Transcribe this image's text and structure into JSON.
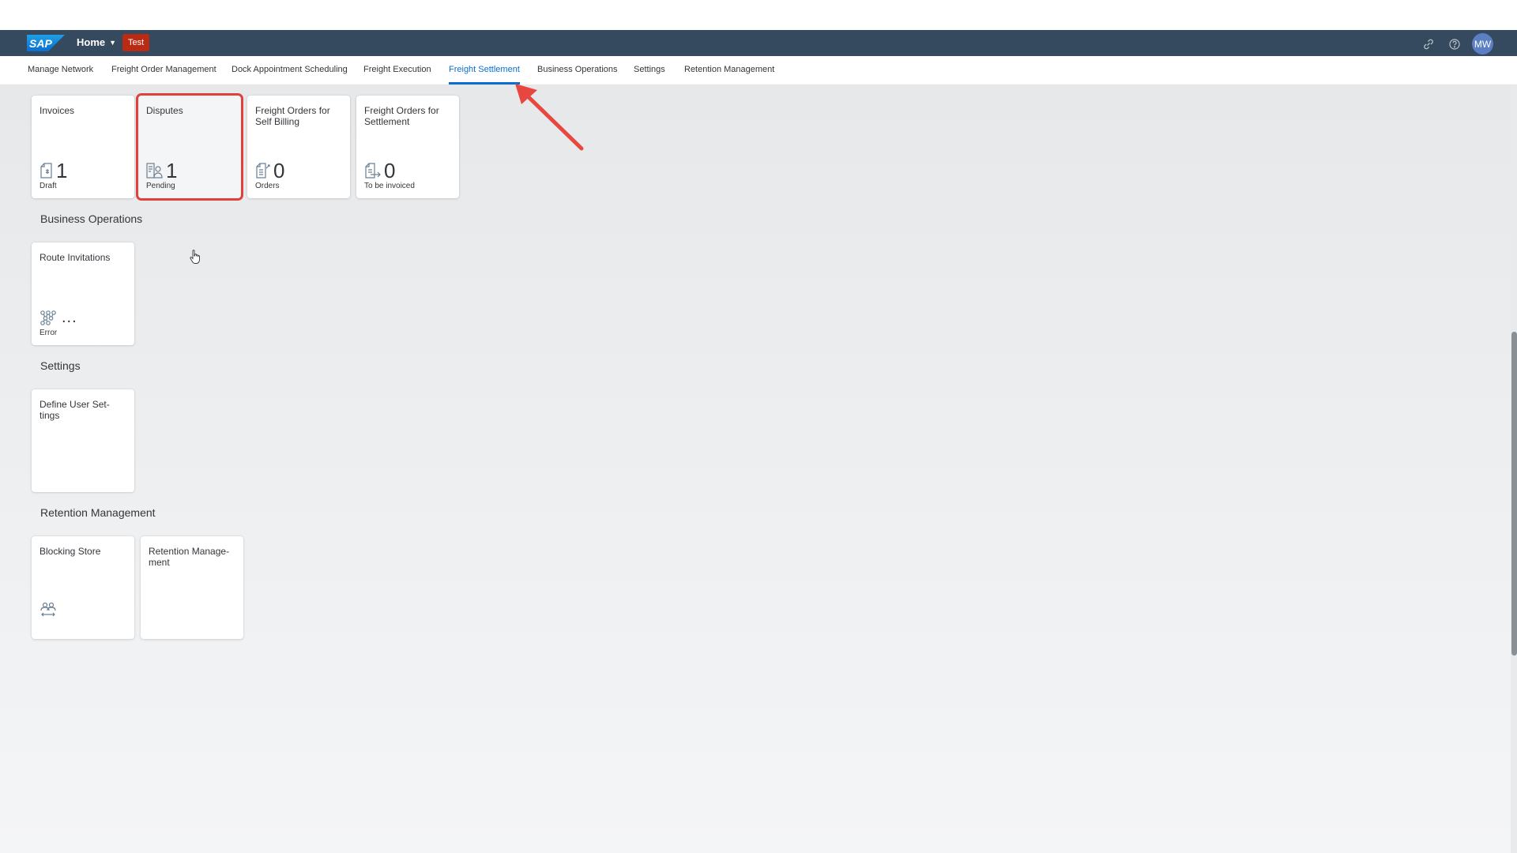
{
  "shell": {
    "logo_text": "SAP",
    "home_label": "Home",
    "env_badge": "Test",
    "avatar_initials": "MW",
    "brand_color": "#354a5f",
    "badge_color": "#bb2a13"
  },
  "nav": {
    "items": [
      {
        "label": "Manage Network"
      },
      {
        "label": "Freight Order Management"
      },
      {
        "label": "Dock Appointment Scheduling"
      },
      {
        "label": "Freight Execution"
      },
      {
        "label": "Freight Settlement"
      },
      {
        "label": "Business Operations"
      },
      {
        "label": "Settings"
      },
      {
        "label": "Retention Management"
      }
    ],
    "active": "Freight Settlement",
    "accent_color": "#0a6ed1"
  },
  "sections": {
    "freight_settlement": {
      "tiles": [
        {
          "title": "Invoices",
          "icon": "invoice-icon",
          "number": "1",
          "footer": "Draft"
        },
        {
          "title": "Disputes",
          "icon": "dispute-icon",
          "number": "1",
          "footer": "Pending"
        },
        {
          "title": "Freight Orders for Self Billing",
          "icon": "self-billing-icon",
          "number": "0",
          "footer": "Orders"
        },
        {
          "title": "Freight Orders for Settlement",
          "icon": "settlement-icon",
          "number": "0",
          "footer": "To be invoiced"
        }
      ]
    },
    "business_operations": {
      "title": "Business Operations",
      "tiles": [
        {
          "title": "Route Invitations",
          "icon": "route-network-icon",
          "number": "...",
          "footer": "Error"
        }
      ]
    },
    "settings": {
      "title": "Settings",
      "tiles": [
        {
          "title": "Define User Set-tings"
        }
      ]
    },
    "retention_management": {
      "title": "Retention Management",
      "tiles": [
        {
          "title": "Blocking Store",
          "icon": "user-transfer-icon"
        },
        {
          "title": "Retention Manage-ment"
        }
      ]
    }
  },
  "annotation": {
    "highlight_color": "#e0413c",
    "arrow_color": "#e8473f"
  }
}
